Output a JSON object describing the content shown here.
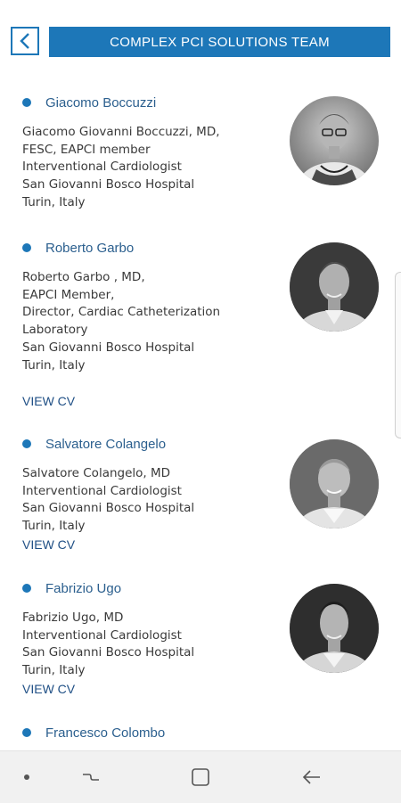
{
  "header": {
    "title": "COMPLEX PCI SOLUTIONS TEAM",
    "back_icon": "chevron-left-icon"
  },
  "colors": {
    "accent": "#1d77b8",
    "name_text": "#2b5f8e",
    "link_text": "#1f4f85"
  },
  "people": [
    {
      "name": "Giacomo Boccuzzi",
      "details": [
        "Giacomo Giovanni Boccuzzi, MD,",
        "FESC, EAPCI member",
        "Interventional Cardiologist",
        "San Giovanni Bosco Hospital",
        "Turin, Italy"
      ],
      "cv_label": ""
    },
    {
      "name": "Roberto Garbo",
      "details": [
        "Roberto Garbo , MD,",
        "EAPCI Member,",
        "Director, Cardiac Catheterization",
        "Laboratory",
        "San Giovanni Bosco Hospital",
        "Turin, Italy"
      ],
      "cv_label": "VIEW CV"
    },
    {
      "name": "Salvatore Colangelo",
      "details": [
        "Salvatore Colangelo, MD",
        "Interventional Cardiologist",
        "San Giovanni Bosco Hospital",
        "Turin, Italy"
      ],
      "cv_label": "VIEW CV"
    },
    {
      "name": "Fabrizio Ugo",
      "details": [
        "Fabrizio Ugo, MD",
        "Interventional Cardiologist",
        "San Giovanni Bosco Hospital",
        "Turin, Italy"
      ],
      "cv_label": "VIEW CV"
    },
    {
      "name": "Francesco Colombo",
      "details": [],
      "cv_label": ""
    }
  ],
  "navbar": {
    "items": [
      "dot-icon",
      "recent-apps-icon",
      "home-icon",
      "back-arrow-icon"
    ]
  }
}
